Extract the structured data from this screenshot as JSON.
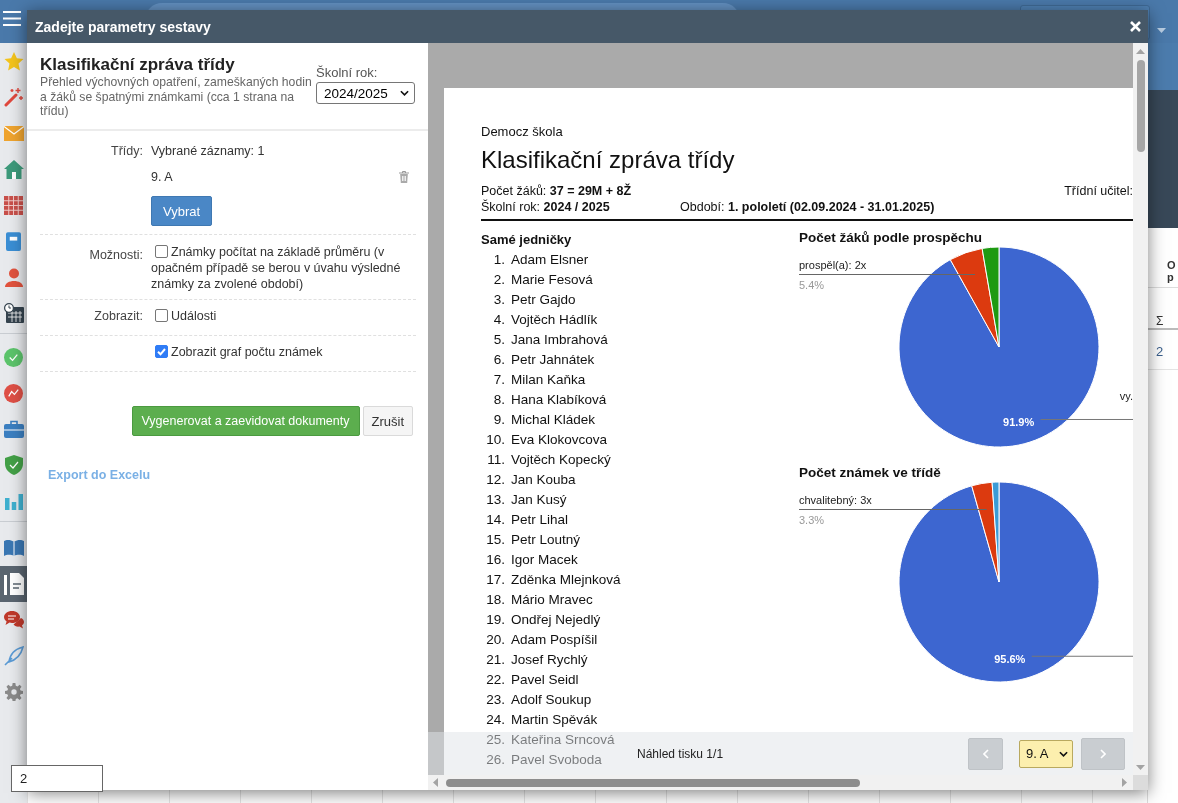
{
  "sidebar": {
    "groups": [
      {
        "items": [
          {
            "kind": "star",
            "selected": false
          },
          {
            "kind": "wand",
            "selected": false
          },
          {
            "kind": "envelope",
            "selected": false
          },
          {
            "kind": "house",
            "selected": false
          },
          {
            "kind": "calendar",
            "selected": false
          },
          {
            "kind": "notebook",
            "selected": false
          },
          {
            "kind": "person",
            "selected": false
          },
          {
            "kind": "calendar-clock",
            "selected": false
          }
        ]
      },
      {
        "items": [
          {
            "kind": "check-circle",
            "selected": false
          },
          {
            "kind": "chart-circle",
            "selected": false
          },
          {
            "kind": "briefcase",
            "selected": false
          },
          {
            "kind": "shield",
            "selected": false
          },
          {
            "kind": "bar-chart",
            "selected": false
          }
        ]
      },
      {
        "items": [
          {
            "kind": "book",
            "selected": false
          },
          {
            "kind": "document",
            "selected": true
          },
          {
            "kind": "chat",
            "selected": false
          },
          {
            "kind": "pen",
            "selected": false
          },
          {
            "kind": "gear",
            "selected": false
          }
        ]
      }
    ],
    "footer_field": {
      "value": "2"
    }
  },
  "background_table": {
    "header_lines": [
      "O",
      "p"
    ],
    "sum_label": "Σ",
    "cells": [
      "2"
    ]
  },
  "dialog": {
    "title": "Zadejte parametry sestavy",
    "report": {
      "title": "Klasifikační zpráva třídy",
      "description": "Přehled výchovných opatření, zameškaných hodin a žáků se špatnými známkami (cca 1 strana na třídu)"
    },
    "school_year": {
      "label": "Školní rok:",
      "value": "2024/2025"
    },
    "classes": {
      "label": "Třídy:",
      "summary": "Vybrané záznamy: 1",
      "items": [
        "9. A"
      ],
      "button": "Vybrat"
    },
    "options": [
      {
        "label": "Možnosti:",
        "text": "Známky počítat na základě průměru (v opačném případě se berou v úvahu výsledné známky za zvolené období)",
        "checked": false
      },
      {
        "label": "Zobrazit:",
        "text": "Události",
        "checked": false
      },
      {
        "text": "Zobrazit graf počtu známek",
        "checked": true
      }
    ],
    "actions": {
      "generate": "Vygenerovat a zaevidovat dokumenty",
      "cancel": "Zrušit"
    },
    "export_link": "Export do Excelu",
    "preview": {
      "school": "Democz škola",
      "title": "Klasifikační zpráva třídy",
      "info": {
        "students": {
          "label": "Počet žáků:",
          "value": "37 = 29M + 8Ž"
        },
        "teacher": {
          "label": "Třídní učitel:"
        },
        "school_year": {
          "label": "Školní rok:",
          "value": "2024 / 2025"
        },
        "period": {
          "label": "Období:",
          "value": "1. pololetí (02.09.2024 - 31.01.2025)"
        }
      },
      "list": {
        "title": "Samé jedničky",
        "items": [
          {
            "number": "1.",
            "name": "Adam Elsner"
          },
          {
            "number": "2.",
            "name": "Marie Fesová"
          },
          {
            "number": "3.",
            "name": "Petr Gajdo"
          },
          {
            "number": "4.",
            "name": "Vojtěch Hádlík"
          },
          {
            "number": "5.",
            "name": "Jana Imbrahová"
          },
          {
            "number": "6.",
            "name": "Petr Jahnátek"
          },
          {
            "number": "7.",
            "name": "Milan Kaňka"
          },
          {
            "number": "8.",
            "name": "Hana Klabíková"
          },
          {
            "number": "9.",
            "name": "Michal Kládek"
          },
          {
            "number": "10.",
            "name": "Eva Klokovcova"
          },
          {
            "number": "11.",
            "name": "Vojtěch Kopecký"
          },
          {
            "number": "12.",
            "name": "Jan Kouba"
          },
          {
            "number": "13.",
            "name": "Jan Kusý"
          },
          {
            "number": "14.",
            "name": "Petr Lihal"
          },
          {
            "number": "15.",
            "name": "Petr Loutný"
          },
          {
            "number": "16.",
            "name": "Igor Macek"
          },
          {
            "number": "17.",
            "name": "Zděnka Mlejnková"
          },
          {
            "number": "18.",
            "name": "Mário Mravec"
          },
          {
            "number": "19.",
            "name": "Ondřej Nejedlý"
          },
          {
            "number": "20.",
            "name": "Adam Pospíšil"
          },
          {
            "number": "21.",
            "name": "Josef Rychlý"
          },
          {
            "number": "22.",
            "name": "Pavel Seidl"
          },
          {
            "number": "23.",
            "name": "Adolf Soukup"
          },
          {
            "number": "24.",
            "name": "Martin Spěvák"
          },
          {
            "number": "25.",
            "name": "Kateřina Srncová"
          },
          {
            "number": "26.",
            "name": "Pavel Svoboda"
          }
        ]
      },
      "charts": [
        {
          "chart_data": {
            "type": "pie",
            "title": "Počet žáků podle prospěchu",
            "values": [
              91.9,
              5.4,
              2.7
            ],
            "colors": [
              "#3d66d0",
              "#dc3a0f",
              "#1e9a12"
            ]
          },
          "callout": {
            "label": "prospěl(a): 2x",
            "percent": "5.4%"
          },
          "inside_label": "91.9%",
          "edge_label": "vy."
        },
        {
          "chart_data": {
            "type": "pie",
            "title": "Počet známek ve třídě",
            "values": [
              95.6,
              3.3,
              1.1
            ],
            "colors": [
              "#3d66d0",
              "#dc3a0f",
              "#3b9bd6"
            ]
          },
          "callout": {
            "label": "chvalitebný: 3x",
            "percent": "3.3%"
          },
          "inside_label": "95.6%"
        }
      ],
      "toolbar": {
        "status": "Náhled tisku 1/1",
        "class_select": "9. A"
      }
    }
  }
}
